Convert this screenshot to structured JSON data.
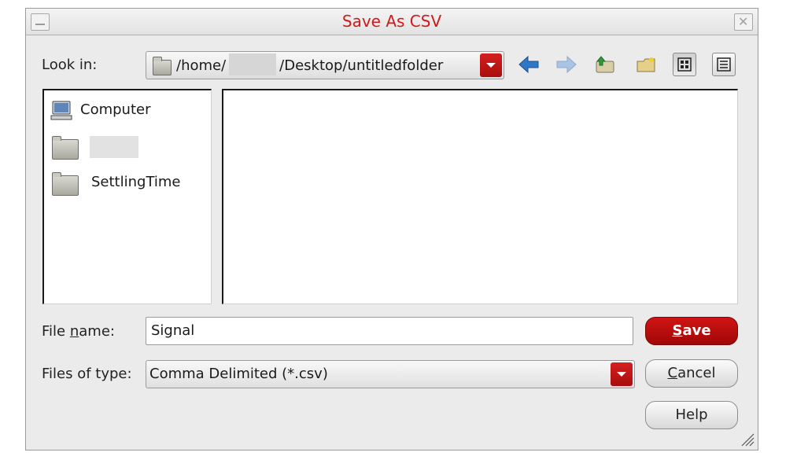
{
  "dialog": {
    "title": "Save As CSV"
  },
  "look_in": {
    "label": "Look in:",
    "path_prefix": "/home/",
    "path_suffix": "/Desktop/untitledfolder"
  },
  "toolbar": {
    "icons": [
      "back-arrow-icon",
      "forward-arrow-icon",
      "up-folder-icon",
      "new-folder-icon",
      "list-view-icon",
      "details-view-icon"
    ]
  },
  "places": {
    "items": [
      {
        "label": "Computer",
        "icon": "computer-icon"
      },
      {
        "label": "",
        "icon": "folder-icon",
        "redacted": true
      },
      {
        "label": "SettlingTime",
        "icon": "folder-icon"
      }
    ]
  },
  "file_name": {
    "label_before": "File ",
    "label_mnemonic": "n",
    "label_after": "ame:",
    "value": "Signal"
  },
  "file_type": {
    "label": "Files of type:",
    "value": "Comma Delimited (*.csv)"
  },
  "buttons": {
    "save_mnemonic": "S",
    "save_rest": "ave",
    "cancel_mnemonic": "C",
    "cancel_rest": "ancel",
    "help": "Help"
  },
  "colors": {
    "title": "#d01a1a",
    "accent_red": "#b80f0f",
    "dialog_bg": "#ebebeb"
  }
}
